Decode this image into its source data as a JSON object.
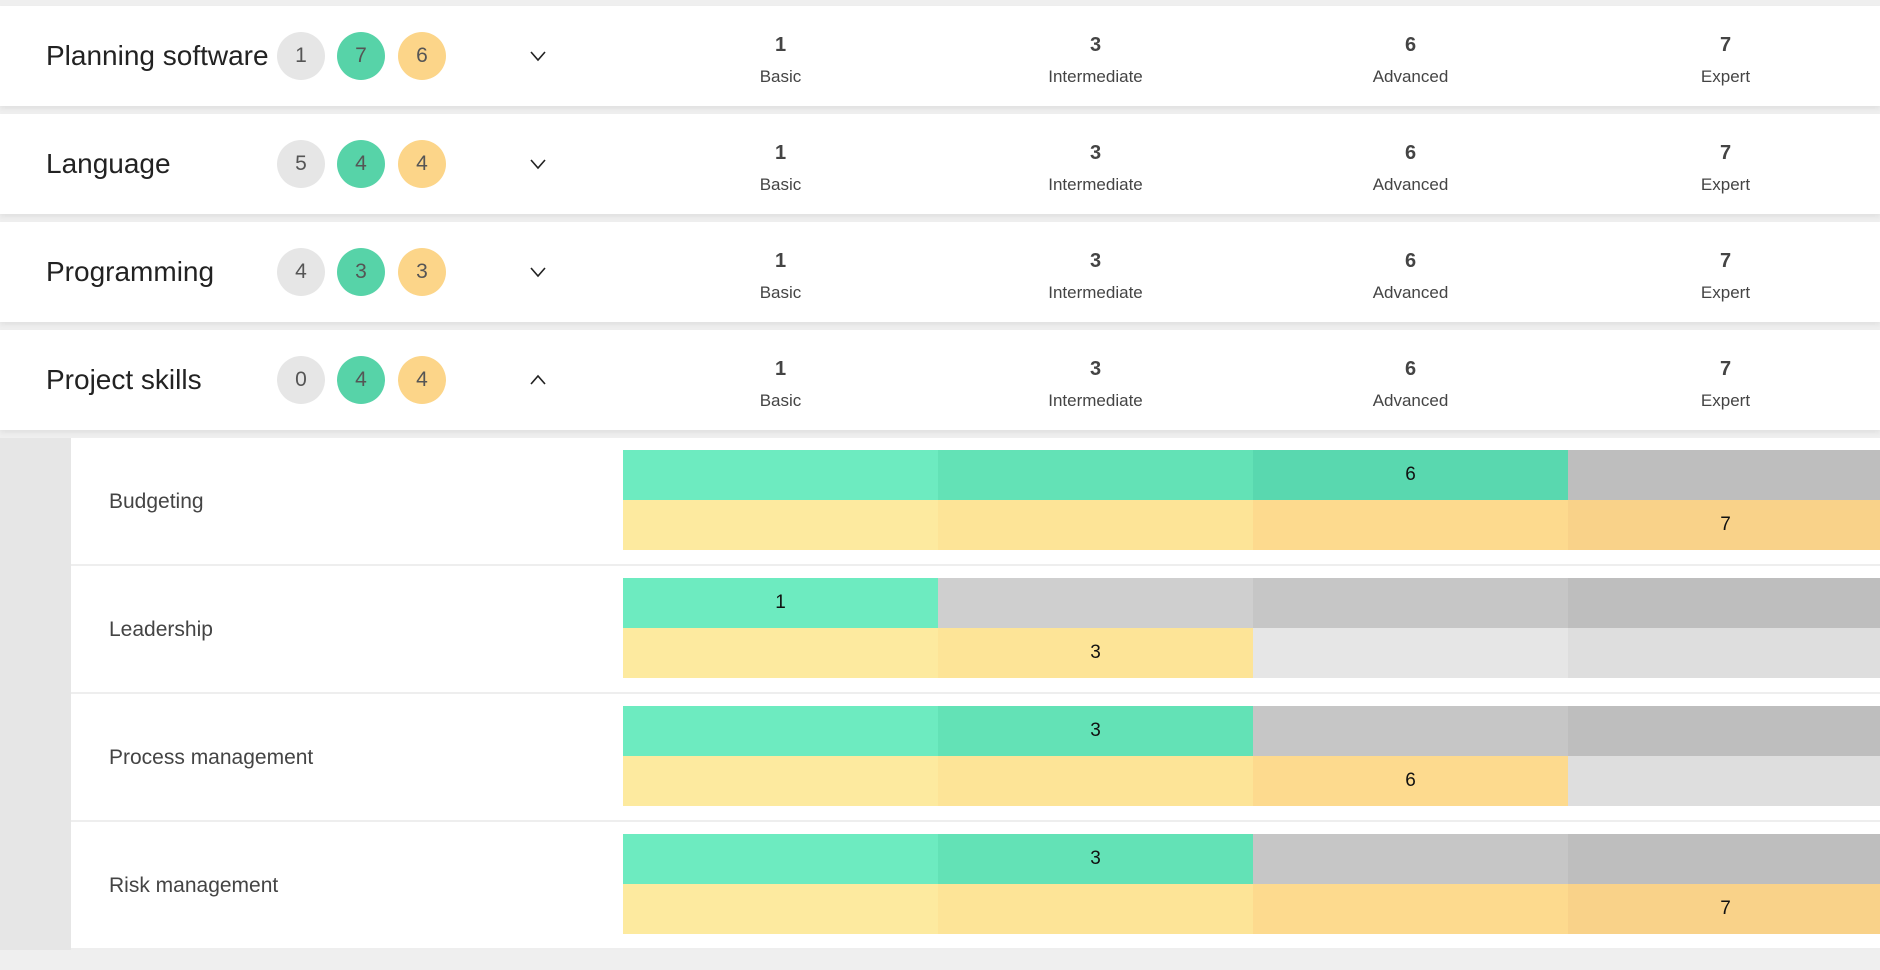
{
  "levels": [
    {
      "value": "1",
      "label": "Basic"
    },
    {
      "value": "3",
      "label": "Intermediate"
    },
    {
      "value": "6",
      "label": "Advanced"
    },
    {
      "value": "7",
      "label": "Expert"
    }
  ],
  "categories": [
    {
      "title": "Planning software",
      "badges": [
        "1",
        "7",
        "6"
      ],
      "expanded": false
    },
    {
      "title": "Language",
      "badges": [
        "5",
        "4",
        "4"
      ],
      "expanded": false
    },
    {
      "title": "Programming",
      "badges": [
        "4",
        "3",
        "3"
      ],
      "expanded": false
    },
    {
      "title": "Project skills",
      "badges": [
        "0",
        "4",
        "4"
      ],
      "expanded": true
    }
  ],
  "skills": [
    {
      "name": "Budgeting",
      "green": 6,
      "yellow": 7
    },
    {
      "name": "Leadership",
      "green": 1,
      "yellow": 3
    },
    {
      "name": "Process management",
      "green": 3,
      "yellow": 6
    },
    {
      "name": "Risk management",
      "green": 3,
      "yellow": 7
    }
  ],
  "colors": {
    "green": [
      "#6debc0",
      "#63e2b6",
      "#59d8af",
      "#52cfa6"
    ],
    "green_empty": [
      "#cfcfcf",
      "#cfcfcf",
      "#c6c6c6",
      "#bebebe"
    ],
    "yellow": [
      "#fdea9f",
      "#fde497",
      "#fdda8e",
      "#f9d289"
    ],
    "yellow_empty": [
      "#e6e6e6",
      "#e6e6e6",
      "#e6e6e6",
      "#dedede"
    ],
    "badge_grey": "#e6e6e6",
    "badge_green": "#57d3a8",
    "badge_yellow": "#fcd589"
  }
}
